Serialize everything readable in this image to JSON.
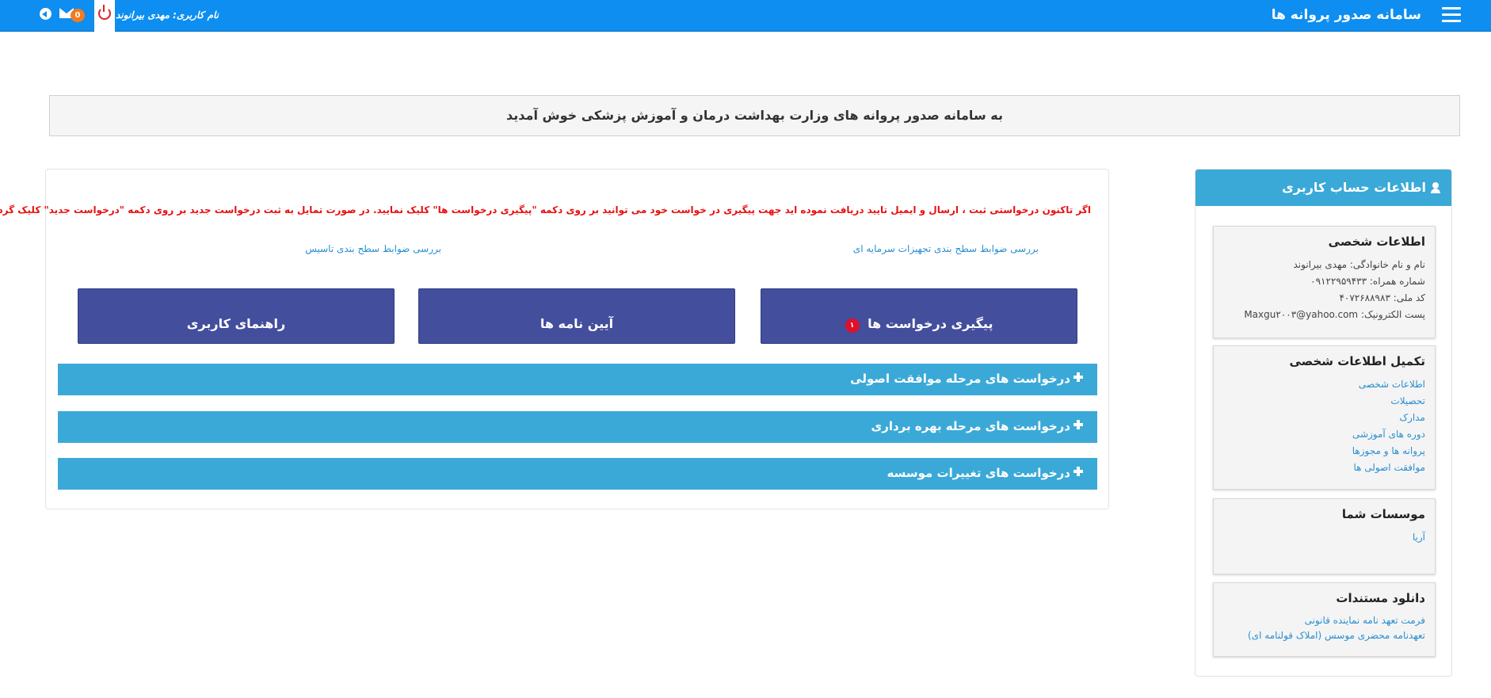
{
  "header": {
    "app_title": "سامانه صدور پروانه ها",
    "username_label": "نام کاربری: مهدی بیرانوند",
    "mail_count": "0"
  },
  "welcome": {
    "text": "به سامانه صدور پروانه های وزارت بهداشت درمان و آموزش پزشکی خوش آمدید"
  },
  "sidebar": {
    "title": "اطلاعات حساب کاربری",
    "personal": {
      "title": "اطلاعات شخصی",
      "name_line": "نام و نام خانوادگی: مهدی بیرانوند",
      "mobile_label": "شماره همراه:",
      "mobile_value": "۰۹۱۲۲۹۵۹۴۳۳",
      "national_id_label": "کد ملی:",
      "national_id_value": "۴۰۷۲۶۸۸۹۸۳",
      "email_label": "پست الکترونیک:",
      "email_value": "Maxgu۲۰۰۳@yahoo.com"
    },
    "complete": {
      "title": "تکمیل اطلاعات شخصی",
      "links": [
        "اطلاعات شخصی",
        "تحصیلات",
        "مدارک",
        "دوره های آموزشی",
        "پروانه ها و مجوزها",
        "موافقت اصولی ها"
      ]
    },
    "institutes": {
      "title": "موسسات شما",
      "items": [
        "آریا"
      ]
    },
    "downloads": {
      "title": "دانلود مستندات",
      "links": [
        "فرمت تعهد نامه نماینده قانونی",
        "تعهدنامه محضری موسس (املاک قولنامه ای)"
      ]
    }
  },
  "main": {
    "notice": "اگر تاکنون درخواستی ثبت ، ارسال  و ایمیل تایید دریافت نموده اید جهت پیگیری در خواست خود می توانید بر روی دکمه \"پیگیری درخواست ها\" کلیک نمایید. در صورت تمایل به ثبت درخواست جدید بر روی دکمه \"درخواست جدید\" کلیک گردد.",
    "link_equipment": "بررسی ضوابط سطح بندی تجهیزات سرمایه ای",
    "link_establishment": "بررسی ضوابط سطح بندی تاسیس",
    "btn_followup": "پیگیری درخواست ها",
    "btn_followup_badge": "۱",
    "btn_regulations": "آیین نامه ها",
    "btn_guide": "راهنمای کاربری",
    "accordion": [
      "درخواست های مرحله موافقت اصولی",
      "درخواست های مرحله بهره برداری",
      "درخواست های تغییرات موسسه"
    ]
  },
  "colors": {
    "topbar": "#0d8ef0",
    "accent": "#3aa9d8",
    "button": "#434e9d",
    "notice": "#e81010",
    "link": "#2a8fd0",
    "mail_badge": "#f47b20",
    "followup_badge": "#e0102a"
  }
}
